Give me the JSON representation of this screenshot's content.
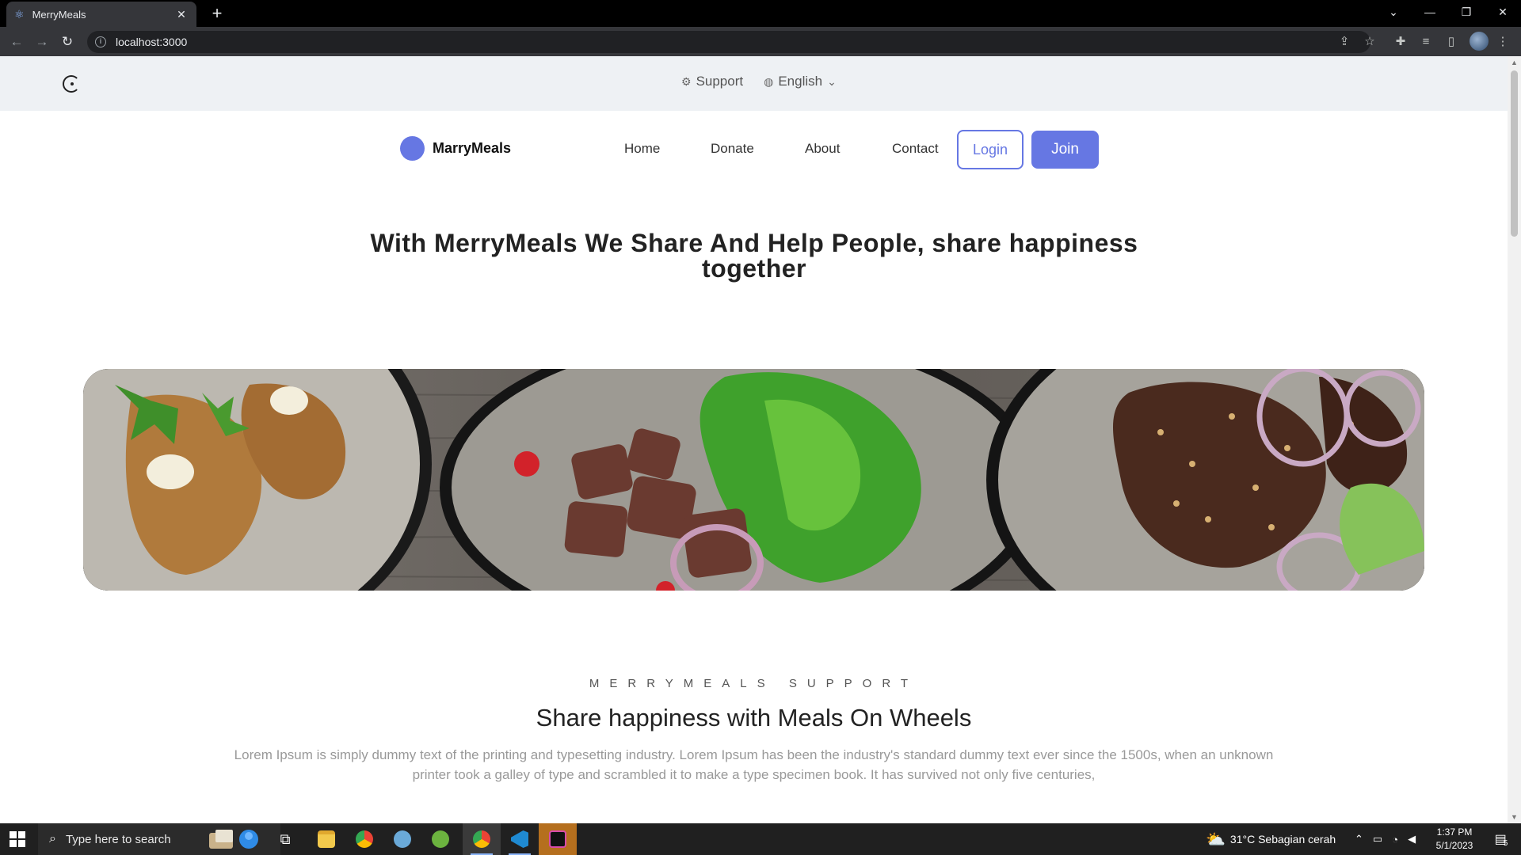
{
  "browser": {
    "tab_title": "MerryMeals",
    "url": "localhost:3000"
  },
  "topbar": {
    "support_label": "Support",
    "language_label": "English"
  },
  "nav": {
    "brand": "MarryMeals",
    "links": [
      "Home",
      "Donate",
      "About",
      "Contact"
    ],
    "login_label": "Login",
    "join_label": "Join"
  },
  "hero": {
    "title": "With MerryMeals We Share And Help People, share happiness together"
  },
  "section": {
    "kicker": "MERRYMEALS SUPPORT",
    "title": "Share happiness with Meals On Wheels",
    "body": "Lorem Ipsum is simply dummy text of the printing and typesetting industry. Lorem Ipsum has been the industry's standard dummy text ever since the 1500s, when an unknown printer took a galley of type and scrambled it to make a type specimen book. It has survived not only five centuries,"
  },
  "taskbar": {
    "search_placeholder": "Type here to search",
    "weather": "31°C  Sebagian cerah",
    "time": "1:37 PM",
    "date": "5/1/2023",
    "notification_count": "5"
  },
  "colors": {
    "accent": "#6677e3",
    "topbar_bg": "#eef1f4"
  }
}
